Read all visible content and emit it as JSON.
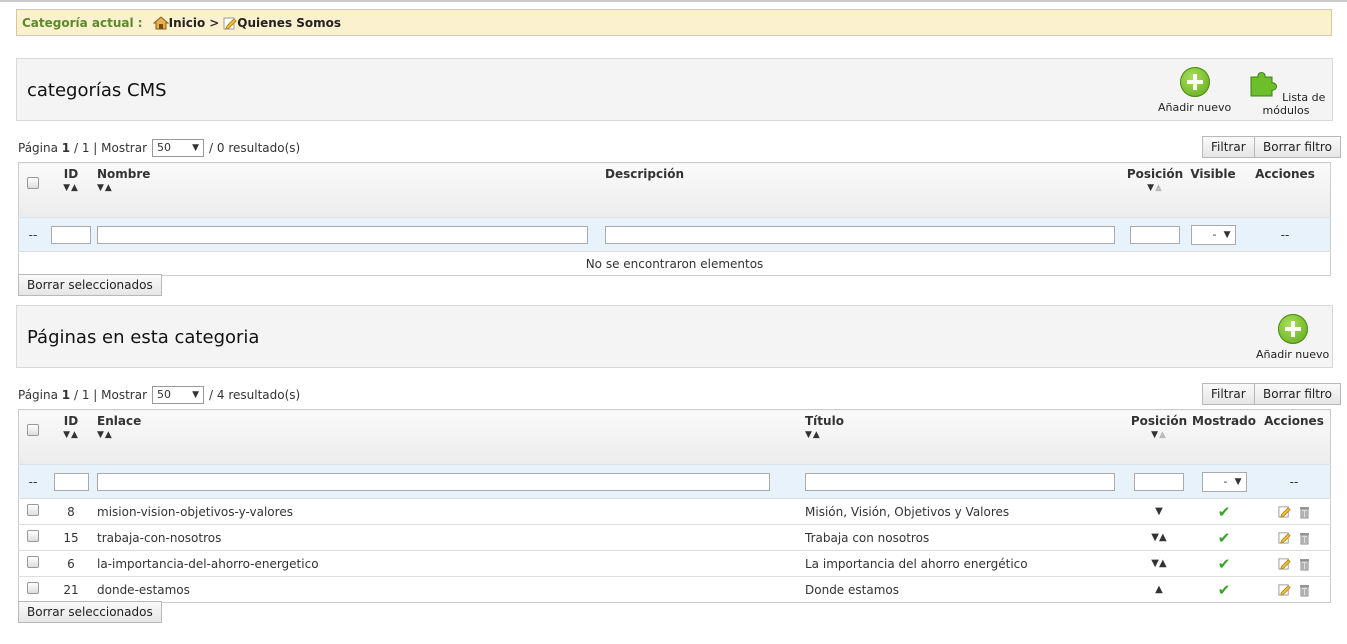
{
  "breadcrumb": {
    "label": "Categoría actual :",
    "home": "Inicio",
    "separator": ">",
    "current": "Quienes Somos"
  },
  "cms": {
    "title": "categorías CMS",
    "add_label": "Añadir nuevo",
    "modules_label": "Lista de módulos",
    "pager": {
      "page_word": "Página",
      "page": "1",
      "total": "1",
      "show": "Mostrar",
      "per_page": "50",
      "results": "/ 0 resultado(s)"
    },
    "filter_btn": "Filtrar",
    "clear_btn": "Borrar filtro",
    "columns": {
      "id": "ID",
      "name": "Nombre",
      "desc": "Descripción",
      "pos": "Posición",
      "visible": "Visible",
      "actions": "Acciones"
    },
    "filter_dash": "--",
    "visible_select": "-",
    "actions_dash": "--",
    "empty": "No se encontraron elementos",
    "delete_selected": "Borrar seleccionados"
  },
  "pages": {
    "title": "Páginas en esta categoria",
    "add_label": "Añadir nuevo",
    "pager": {
      "page_word": "Página",
      "page": "1",
      "total": "1",
      "show": "Mostrar",
      "per_page": "50",
      "results": "/ 4 resultado(s)"
    },
    "filter_btn": "Filtrar",
    "clear_btn": "Borrar filtro",
    "columns": {
      "id": "ID",
      "link": "Enlace",
      "title": "Título",
      "pos": "Posición",
      "shown": "Mostrado",
      "actions": "Acciones"
    },
    "filter_dash": "--",
    "shown_select": "-",
    "actions_dash": "--",
    "rows": [
      {
        "id": "8",
        "link": "mision-vision-objetivos-y-valores",
        "title": "Misión, Visión, Objetivos y Valores",
        "pos": "▼"
      },
      {
        "id": "15",
        "link": "trabaja-con-nosotros",
        "title": "Trabaja con nosotros",
        "pos": "▼▲"
      },
      {
        "id": "6",
        "link": "la-importancia-del-ahorro-energetico",
        "title": "La importancia del ahorro energético",
        "pos": "▼▲"
      },
      {
        "id": "21",
        "link": "donde-estamos",
        "title": "Donde estamos",
        "pos": "▲"
      }
    ],
    "delete_selected": "Borrar seleccionados"
  },
  "colors": {
    "accent_green": "#5ca518",
    "breadcrumb_bg": "#fbf1cf",
    "filter_row": "#e8f2fb"
  }
}
